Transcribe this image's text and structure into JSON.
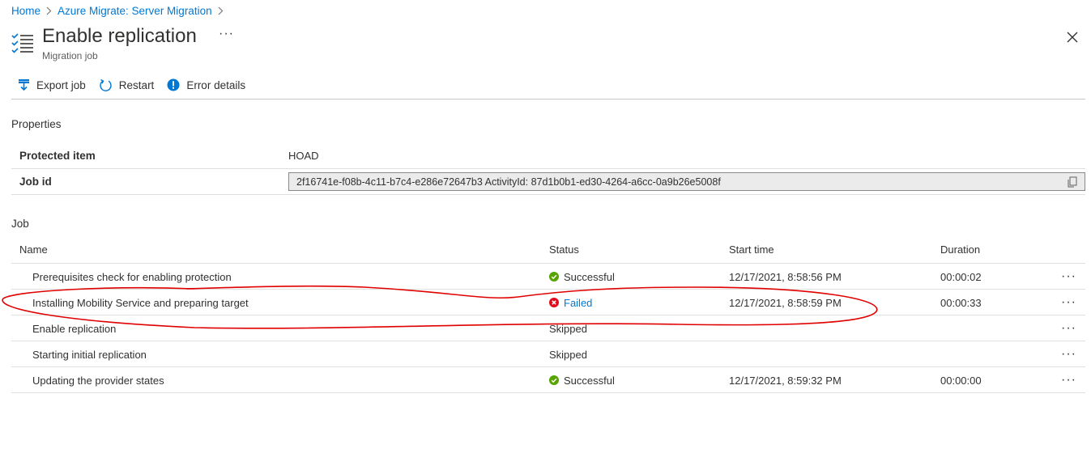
{
  "breadcrumb": {
    "items": [
      "Home",
      "Azure Migrate: Server Migration"
    ]
  },
  "header": {
    "title": "Enable replication",
    "subtitle": "Migration job",
    "more": "···"
  },
  "toolbar": {
    "export_label": "Export job",
    "restart_label": "Restart",
    "error_details_label": "Error details"
  },
  "properties": {
    "section_label": "Properties",
    "protected_item_label": "Protected item",
    "protected_item_value": "HOAD",
    "job_id_label": "Job id",
    "job_id_value": "2f16741e-f08b-4c11-b7c4-e286e72647b3 ActivityId: 87d1b0b1-ed30-4264-a6cc-0a9b26e5008f"
  },
  "job": {
    "section_label": "Job",
    "columns": {
      "name": "Name",
      "status": "Status",
      "start_time": "Start time",
      "duration": "Duration"
    },
    "rows": [
      {
        "name": "Prerequisites check for enabling protection",
        "status": "Successful",
        "start_time": "12/17/2021, 8:58:56 PM",
        "duration": "00:00:02",
        "more": "···"
      },
      {
        "name": "Installing Mobility Service and preparing target",
        "status": "Failed",
        "start_time": "12/17/2021, 8:58:59 PM",
        "duration": "00:00:33",
        "more": "···"
      },
      {
        "name": "Enable replication",
        "status": "Skipped",
        "start_time": "",
        "duration": "",
        "more": "···"
      },
      {
        "name": "Starting initial replication",
        "status": "Skipped",
        "start_time": "",
        "duration": "",
        "more": "···"
      },
      {
        "name": "Updating the provider states",
        "status": "Successful",
        "start_time": "12/17/2021, 8:59:32 PM",
        "duration": "00:00:00",
        "more": "···"
      }
    ]
  },
  "colors": {
    "link": "#0078d4",
    "success": "#57a300",
    "failed": "#e00b1c",
    "annotation": "#e00000"
  }
}
